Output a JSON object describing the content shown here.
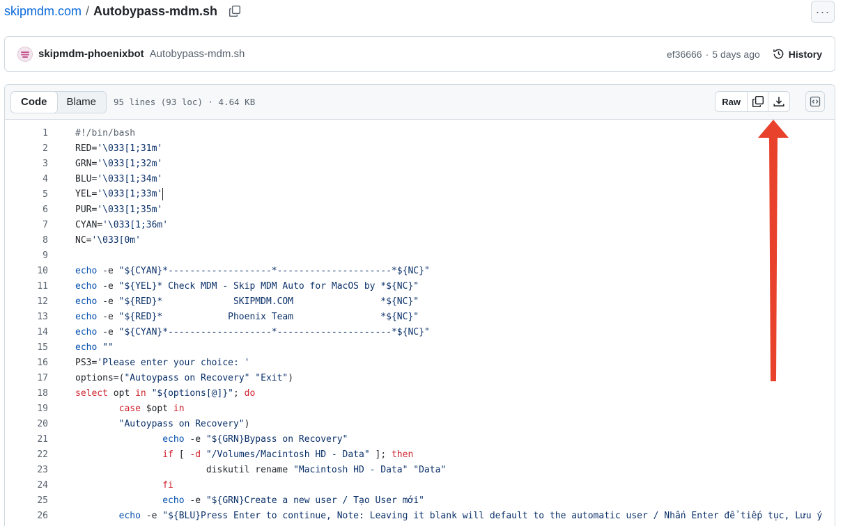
{
  "breadcrumb": {
    "repo": "skipmdm.com",
    "separator": "/",
    "file": "Autobypass-mdm.sh"
  },
  "more_label": "···",
  "commit": {
    "author": "skipmdm-phoenixbot",
    "message": "Autobypass-mdm.sh",
    "sha": "ef36666",
    "dot": "·",
    "age": "5 days ago",
    "history_label": "History"
  },
  "file_header": {
    "tabs": [
      {
        "label": "Code",
        "active": true
      },
      {
        "label": "Blame",
        "active": false
      }
    ],
    "meta": "95 lines (93 loc) · 4.64 KB",
    "raw_label": "Raw"
  },
  "code_lines": [
    [
      [
        "cm",
        "#!/bin/bash"
      ]
    ],
    [
      [
        "",
        "RED="
      ],
      [
        "str",
        "'\\033[1;31m'"
      ]
    ],
    [
      [
        "",
        "GRN="
      ],
      [
        "str",
        "'\\033[1;32m'"
      ]
    ],
    [
      [
        "",
        "BLU="
      ],
      [
        "str",
        "'\\033[1;34m'"
      ]
    ],
    [
      [
        "",
        "YEL="
      ],
      [
        "str",
        "'\\033[1;33m'"
      ]
    ],
    [
      [
        "",
        "PUR="
      ],
      [
        "str",
        "'\\033[1;35m'"
      ]
    ],
    [
      [
        "",
        "CYAN="
      ],
      [
        "str",
        "'\\033[1;36m'"
      ]
    ],
    [
      [
        "",
        "NC="
      ],
      [
        "str",
        "'\\033[0m'"
      ]
    ],
    [
      [
        "",
        ""
      ]
    ],
    [
      [
        "fn",
        "echo"
      ],
      [
        "",
        " -e "
      ],
      [
        "str",
        "\"${CYAN}*-------------------*---------------------*${NC}\""
      ]
    ],
    [
      [
        "fn",
        "echo"
      ],
      [
        "",
        " -e "
      ],
      [
        "str",
        "\"${YEL}* Check MDM - Skip MDM Auto for MacOS by *${NC}\""
      ]
    ],
    [
      [
        "fn",
        "echo"
      ],
      [
        "",
        " -e "
      ],
      [
        "str",
        "\"${RED}*             SKIPMDM.COM                *${NC}\""
      ]
    ],
    [
      [
        "fn",
        "echo"
      ],
      [
        "",
        " -e "
      ],
      [
        "str",
        "\"${RED}*            Phoenix Team                *${NC}\""
      ]
    ],
    [
      [
        "fn",
        "echo"
      ],
      [
        "",
        " -e "
      ],
      [
        "str",
        "\"${CYAN}*-------------------*---------------------*${NC}\""
      ]
    ],
    [
      [
        "fn",
        "echo"
      ],
      [
        "",
        " "
      ],
      [
        "str",
        "\"\""
      ]
    ],
    [
      [
        "",
        "PS3="
      ],
      [
        "str",
        "'Please enter your choice: '"
      ]
    ],
    [
      [
        "",
        "options=("
      ],
      [
        "str",
        "\"Autoypass on Recovery\""
      ],
      [
        "",
        " "
      ],
      [
        "str",
        "\"Exit\""
      ],
      [
        "",
        ")"
      ]
    ],
    [
      [
        "kw",
        "select"
      ],
      [
        "",
        " opt "
      ],
      [
        "kw",
        "in"
      ],
      [
        "",
        " "
      ],
      [
        "str",
        "\"${options[@]}\""
      ],
      [
        "",
        "; "
      ],
      [
        "kw",
        "do"
      ]
    ],
    [
      [
        "",
        "        "
      ],
      [
        "kw",
        "case"
      ],
      [
        "",
        " $opt "
      ],
      [
        "kw",
        "in"
      ]
    ],
    [
      [
        "",
        "        "
      ],
      [
        "str",
        "\"Autoypass on Recovery\""
      ],
      [
        "",
        ")"
      ]
    ],
    [
      [
        "",
        "                "
      ],
      [
        "fn",
        "echo"
      ],
      [
        "",
        " -e "
      ],
      [
        "str",
        "\"${GRN}Bypass on Recovery\""
      ]
    ],
    [
      [
        "",
        "                "
      ],
      [
        "kw",
        "if"
      ],
      [
        "",
        " [ "
      ],
      [
        "kw",
        "-d"
      ],
      [
        "",
        " "
      ],
      [
        "str",
        "\"/Volumes/Macintosh HD - Data\""
      ],
      [
        "",
        " ]; "
      ],
      [
        "kw",
        "then"
      ]
    ],
    [
      [
        "",
        "                        diskutil rename "
      ],
      [
        "str",
        "\"Macintosh HD - Data\""
      ],
      [
        "",
        " "
      ],
      [
        "str",
        "\"Data\""
      ]
    ],
    [
      [
        "",
        "                "
      ],
      [
        "kw",
        "fi"
      ]
    ],
    [
      [
        "",
        "                "
      ],
      [
        "fn",
        "echo"
      ],
      [
        "",
        " -e "
      ],
      [
        "str",
        "\"${GRN}Create a new user / Tạo User mới\""
      ]
    ],
    [
      [
        "",
        "        "
      ],
      [
        "fn",
        "echo"
      ],
      [
        "",
        " -e "
      ],
      [
        "str",
        "\"${BLU}Press Enter to continue, Note: Leaving it blank will default to the automatic user / Nhấn Enter để tiếp tục, Lưu ý"
      ]
    ]
  ],
  "colors": {
    "link": "#0969da",
    "keyword": "#cf222e",
    "function": "#0550ae",
    "string": "#0a3069",
    "arrow": "#e8412c"
  }
}
